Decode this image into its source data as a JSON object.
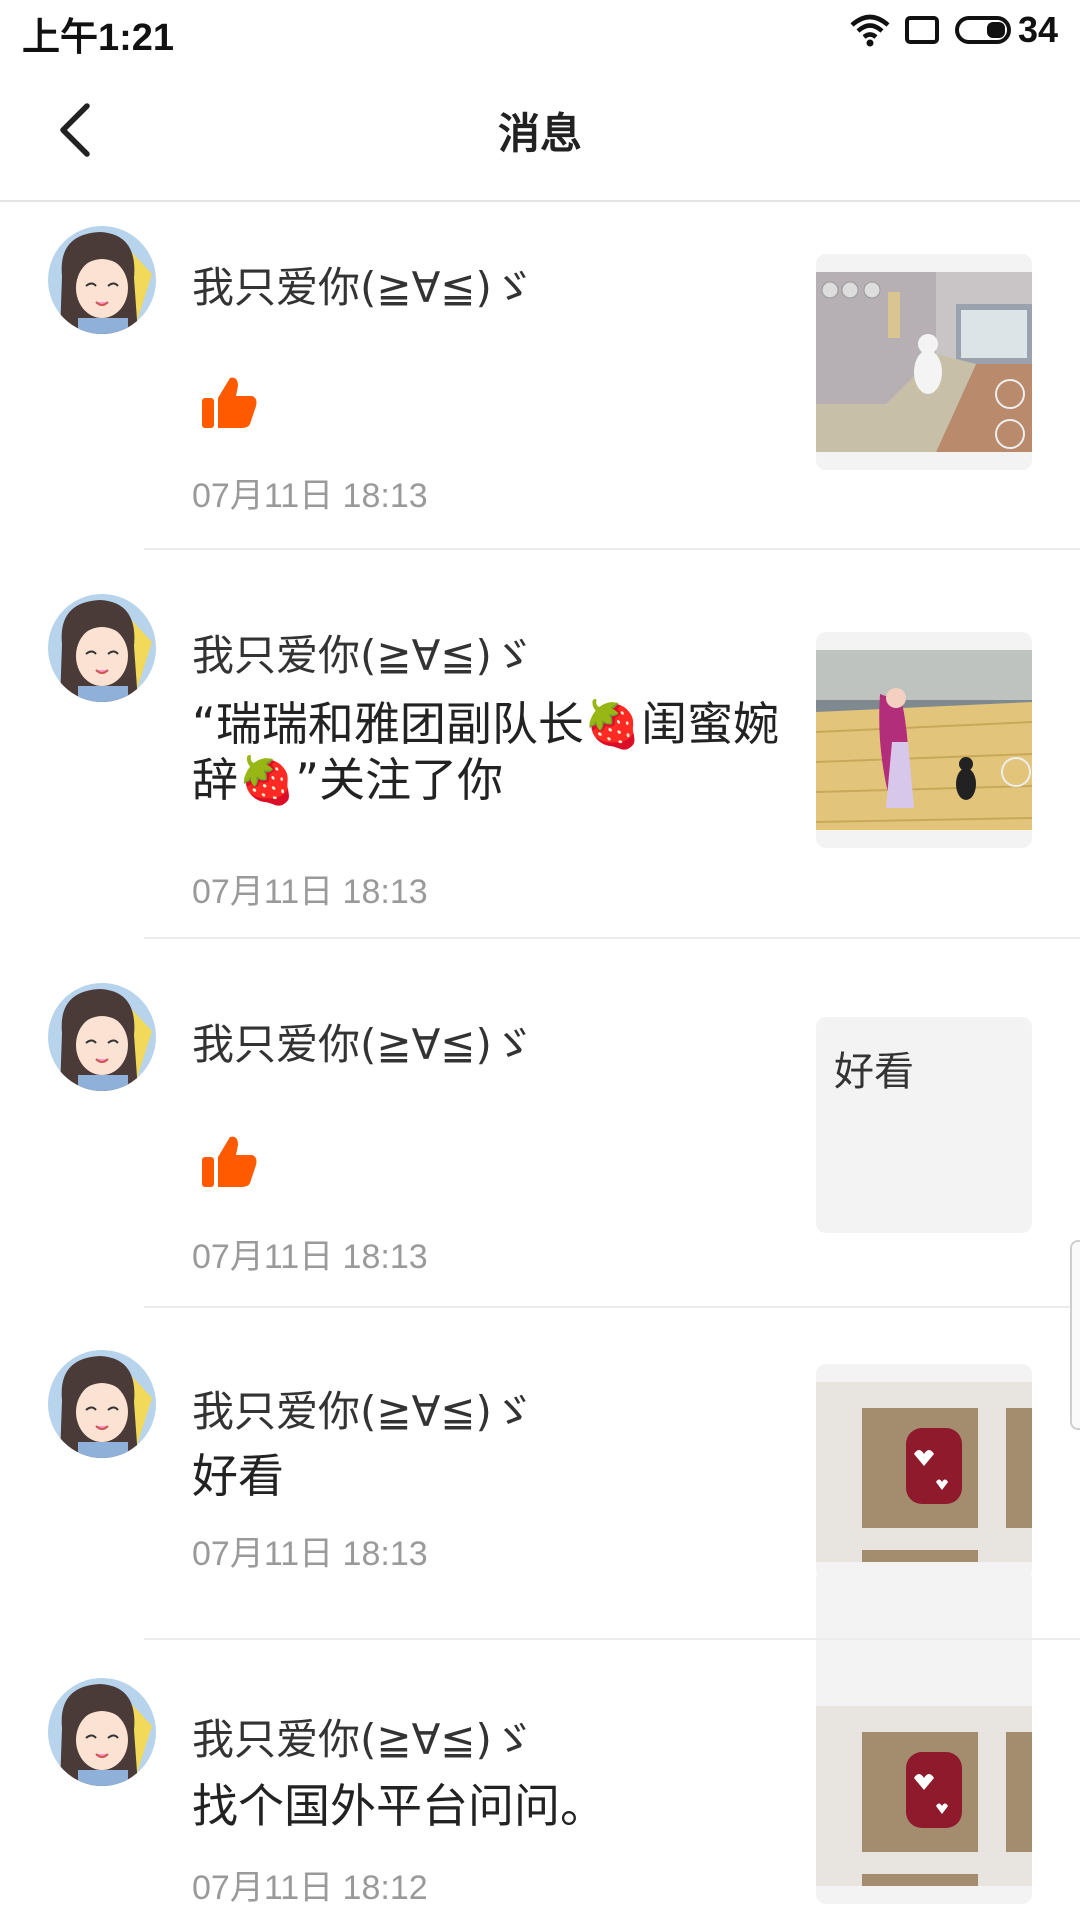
{
  "status_bar": {
    "time": "上午1:21",
    "battery": "34"
  },
  "header": {
    "title": "消息"
  },
  "messages": [
    {
      "user": "我只爱你(≧∀≦)ゞ",
      "type": "like",
      "text": "",
      "time": "07月11日 18:13",
      "thumb": "game-screenshot-room"
    },
    {
      "user": "我只爱你(≧∀≦)ゞ",
      "type": "follow",
      "text": "“瑞瑞和雅团副队长🍓闺蜜婉辞🍓”关注了你",
      "time": "07月11日 18:13",
      "thumb": "game-screenshot-floor"
    },
    {
      "user": "我只爱你(≧∀≦)ゞ",
      "type": "like",
      "text": "",
      "time": "07月11日 18:13",
      "thumb_text": "好看"
    },
    {
      "user": "我只爱你(≧∀≦)ゞ",
      "type": "comment",
      "text": "好看",
      "time": "07月11日 18:13",
      "thumb": "nail-photo"
    },
    {
      "user": "我只爱你(≧∀≦)ゞ",
      "type": "comment",
      "text": "找个国外平台问问。",
      "time": "07月11日 18:12",
      "thumb": "nail-photo"
    }
  ],
  "colors": {
    "like": "#ff5a00",
    "time": "#9a9a9a",
    "divider": "#ececec"
  }
}
